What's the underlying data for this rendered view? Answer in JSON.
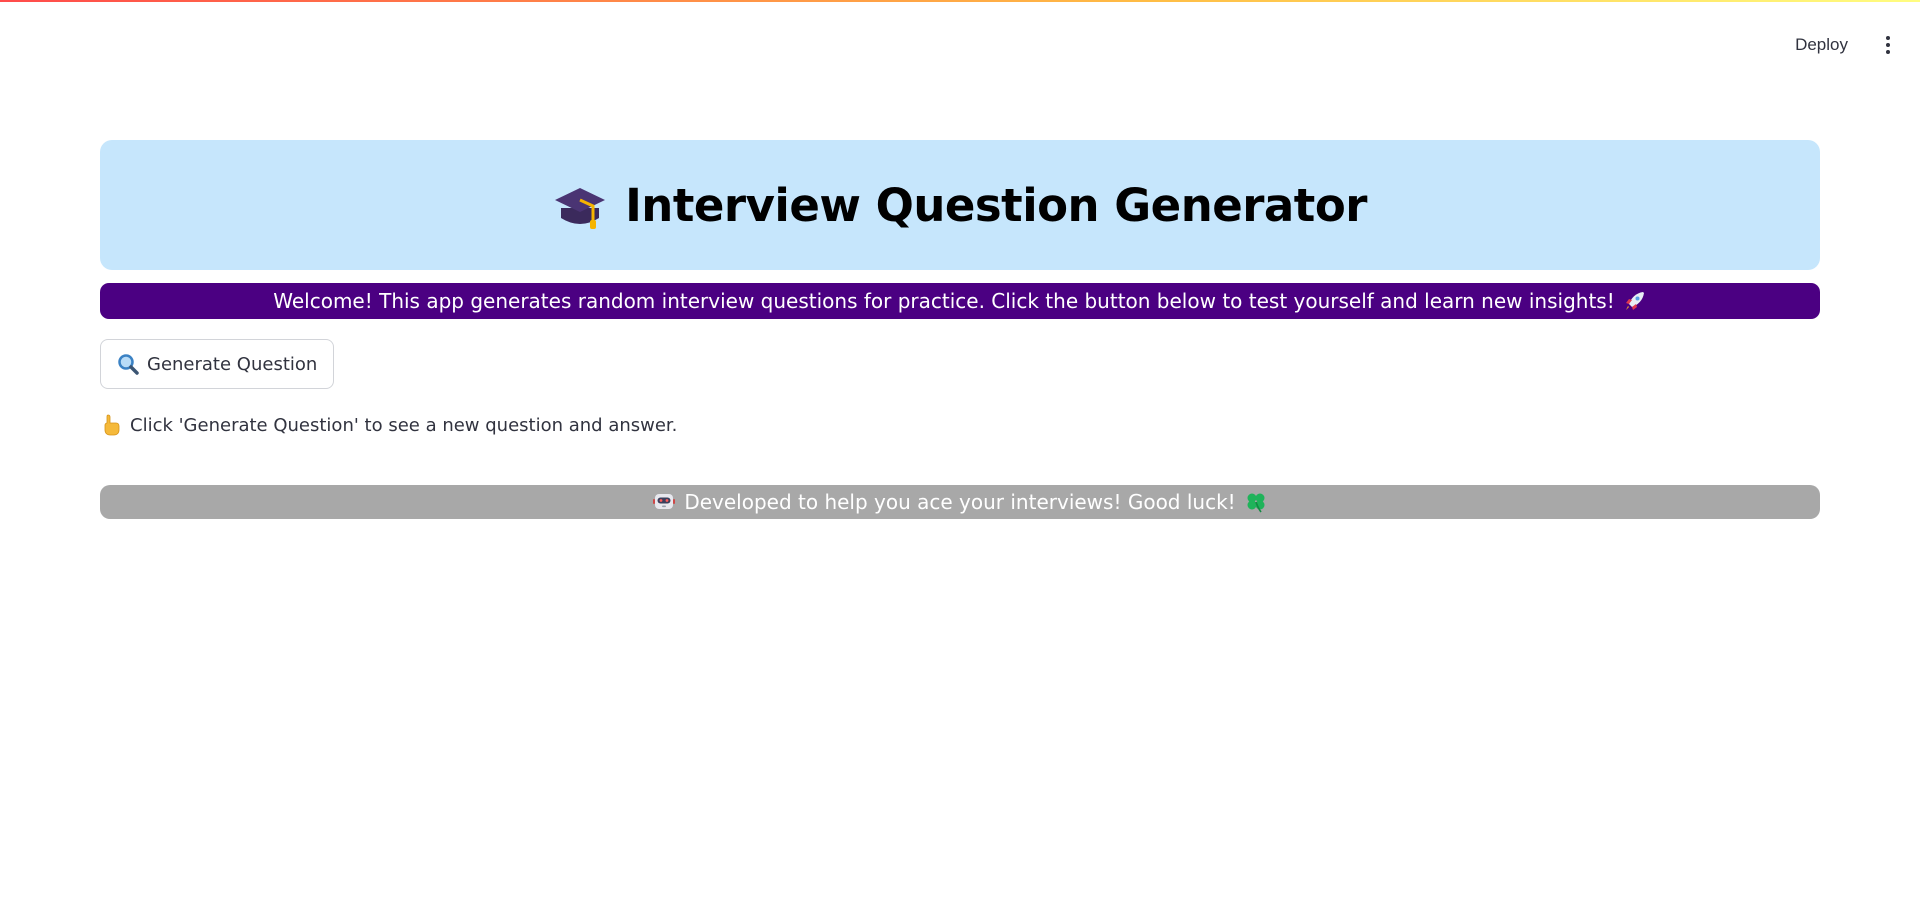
{
  "toolbar": {
    "deploy_label": "Deploy",
    "menu_icon": "more-vertical-icon"
  },
  "header": {
    "icon": "graduation-cap-icon",
    "title": "Interview Question Generator",
    "background": "#c6e6fc"
  },
  "welcome": {
    "text": "Welcome! This app generates random interview questions for practice. Click the button below to test yourself and learn new insights!",
    "icon": "rocket-icon",
    "background": "#4b0082"
  },
  "generate_button": {
    "icon": "search-icon",
    "label": "Generate Question"
  },
  "hint": {
    "icon": "pointing-hand-icon",
    "text": "Click 'Generate Question' to see a new question and answer."
  },
  "footer": {
    "icon_left": "robot-icon",
    "text": "Developed to help you ace your interviews! Good luck!",
    "icon_right": "four-leaf-clover-icon",
    "background": "#a8a8a8"
  }
}
